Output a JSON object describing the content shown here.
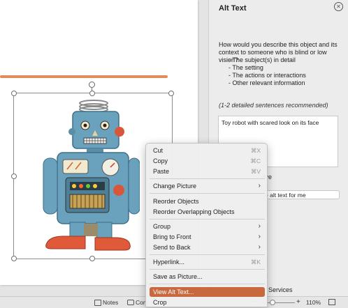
{
  "pane": {
    "title": "Alt Text",
    "close_icon": "close-icon",
    "question": "How would you describe this object and its context to someone who is blind or low vision?",
    "bullets": [
      "- The subject(s) in detail",
      "- The setting",
      "- The actions or interactions",
      "- Other relevant information"
    ],
    "recommendation": "(1-2 detailed sentences recommended)",
    "alt_text_value": "Toy robot with scared look on its face",
    "decorative_label_partial": "tive",
    "generate_button_partial": "e alt text for me",
    "services_partial": "Services"
  },
  "statusbar": {
    "notes_label": "Notes",
    "comments_label_partial": "Com",
    "zoom_level": "110%"
  },
  "context_menu": {
    "items": [
      {
        "label": "Cut",
        "shortcut": "⌘X"
      },
      {
        "label": "Copy",
        "shortcut": "⌘C"
      },
      {
        "label": "Paste",
        "shortcut": "⌘V"
      },
      {
        "label": "Change Picture",
        "submenu": true
      },
      {
        "label": "Reorder Objects"
      },
      {
        "label": "Reorder Overlapping Objects"
      },
      {
        "label": "Group",
        "submenu": true
      },
      {
        "label": "Bring to Front",
        "submenu": true
      },
      {
        "label": "Send to Back",
        "submenu": true
      },
      {
        "label": "Hyperlink...",
        "shortcut": "⌘K"
      },
      {
        "label": "Save as Picture..."
      },
      {
        "label": "View Alt Text...",
        "highlighted": true
      },
      {
        "label": "Crop"
      }
    ]
  },
  "colors": {
    "accent_orange_line": "#e08d5a",
    "menu_highlight": "#c8683e"
  }
}
